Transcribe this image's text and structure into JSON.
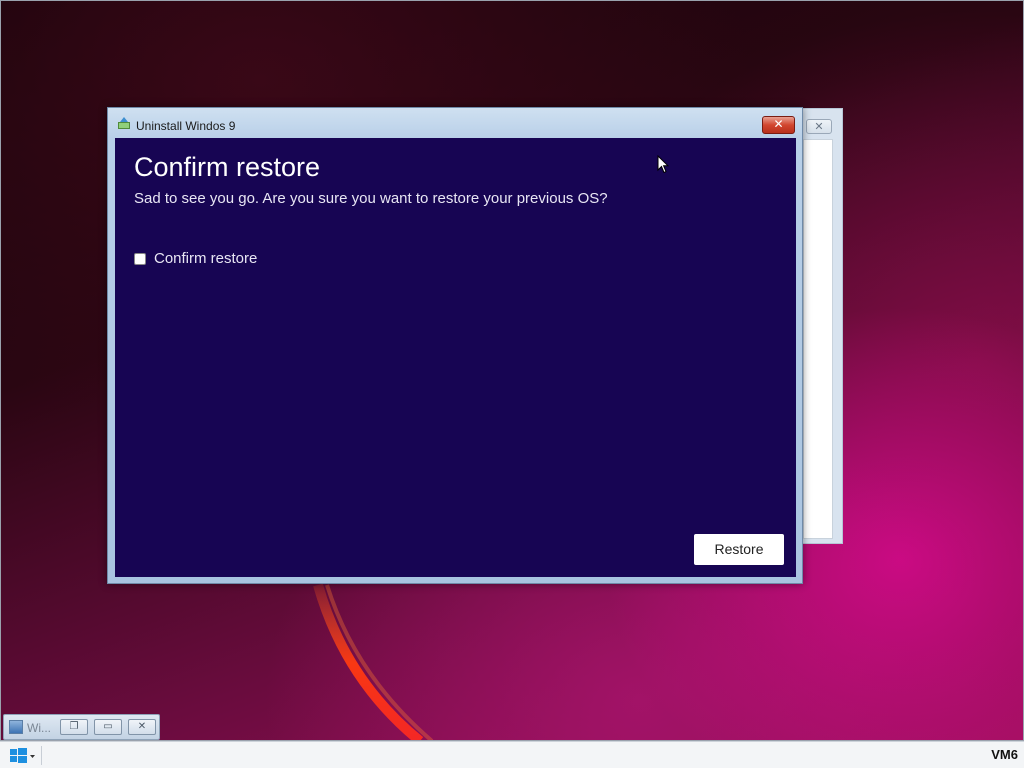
{
  "window": {
    "title": "Uninstall Windos 9",
    "close_symbol": "✕",
    "heading": "Confirm restore",
    "subtitle": "Sad to see you go. Are you sure you want to restore your previous OS?",
    "checkbox_label": "Confirm restore",
    "checkbox_checked": false,
    "restore_label": "Restore"
  },
  "background_window": {
    "close_symbol": "✕"
  },
  "minimized_window": {
    "label": "Wi...",
    "restore_symbol": "❐",
    "maximize_symbol": "▭",
    "close_symbol": "✕"
  },
  "taskbar": {
    "start_icon": "windows-logo-icon",
    "tray_label": "VM6"
  },
  "colors": {
    "dialog_background": "#170553",
    "titlebar": "#b9d0e8",
    "close_button": "#d2462f",
    "desktop_accent": "#d60a8c"
  }
}
